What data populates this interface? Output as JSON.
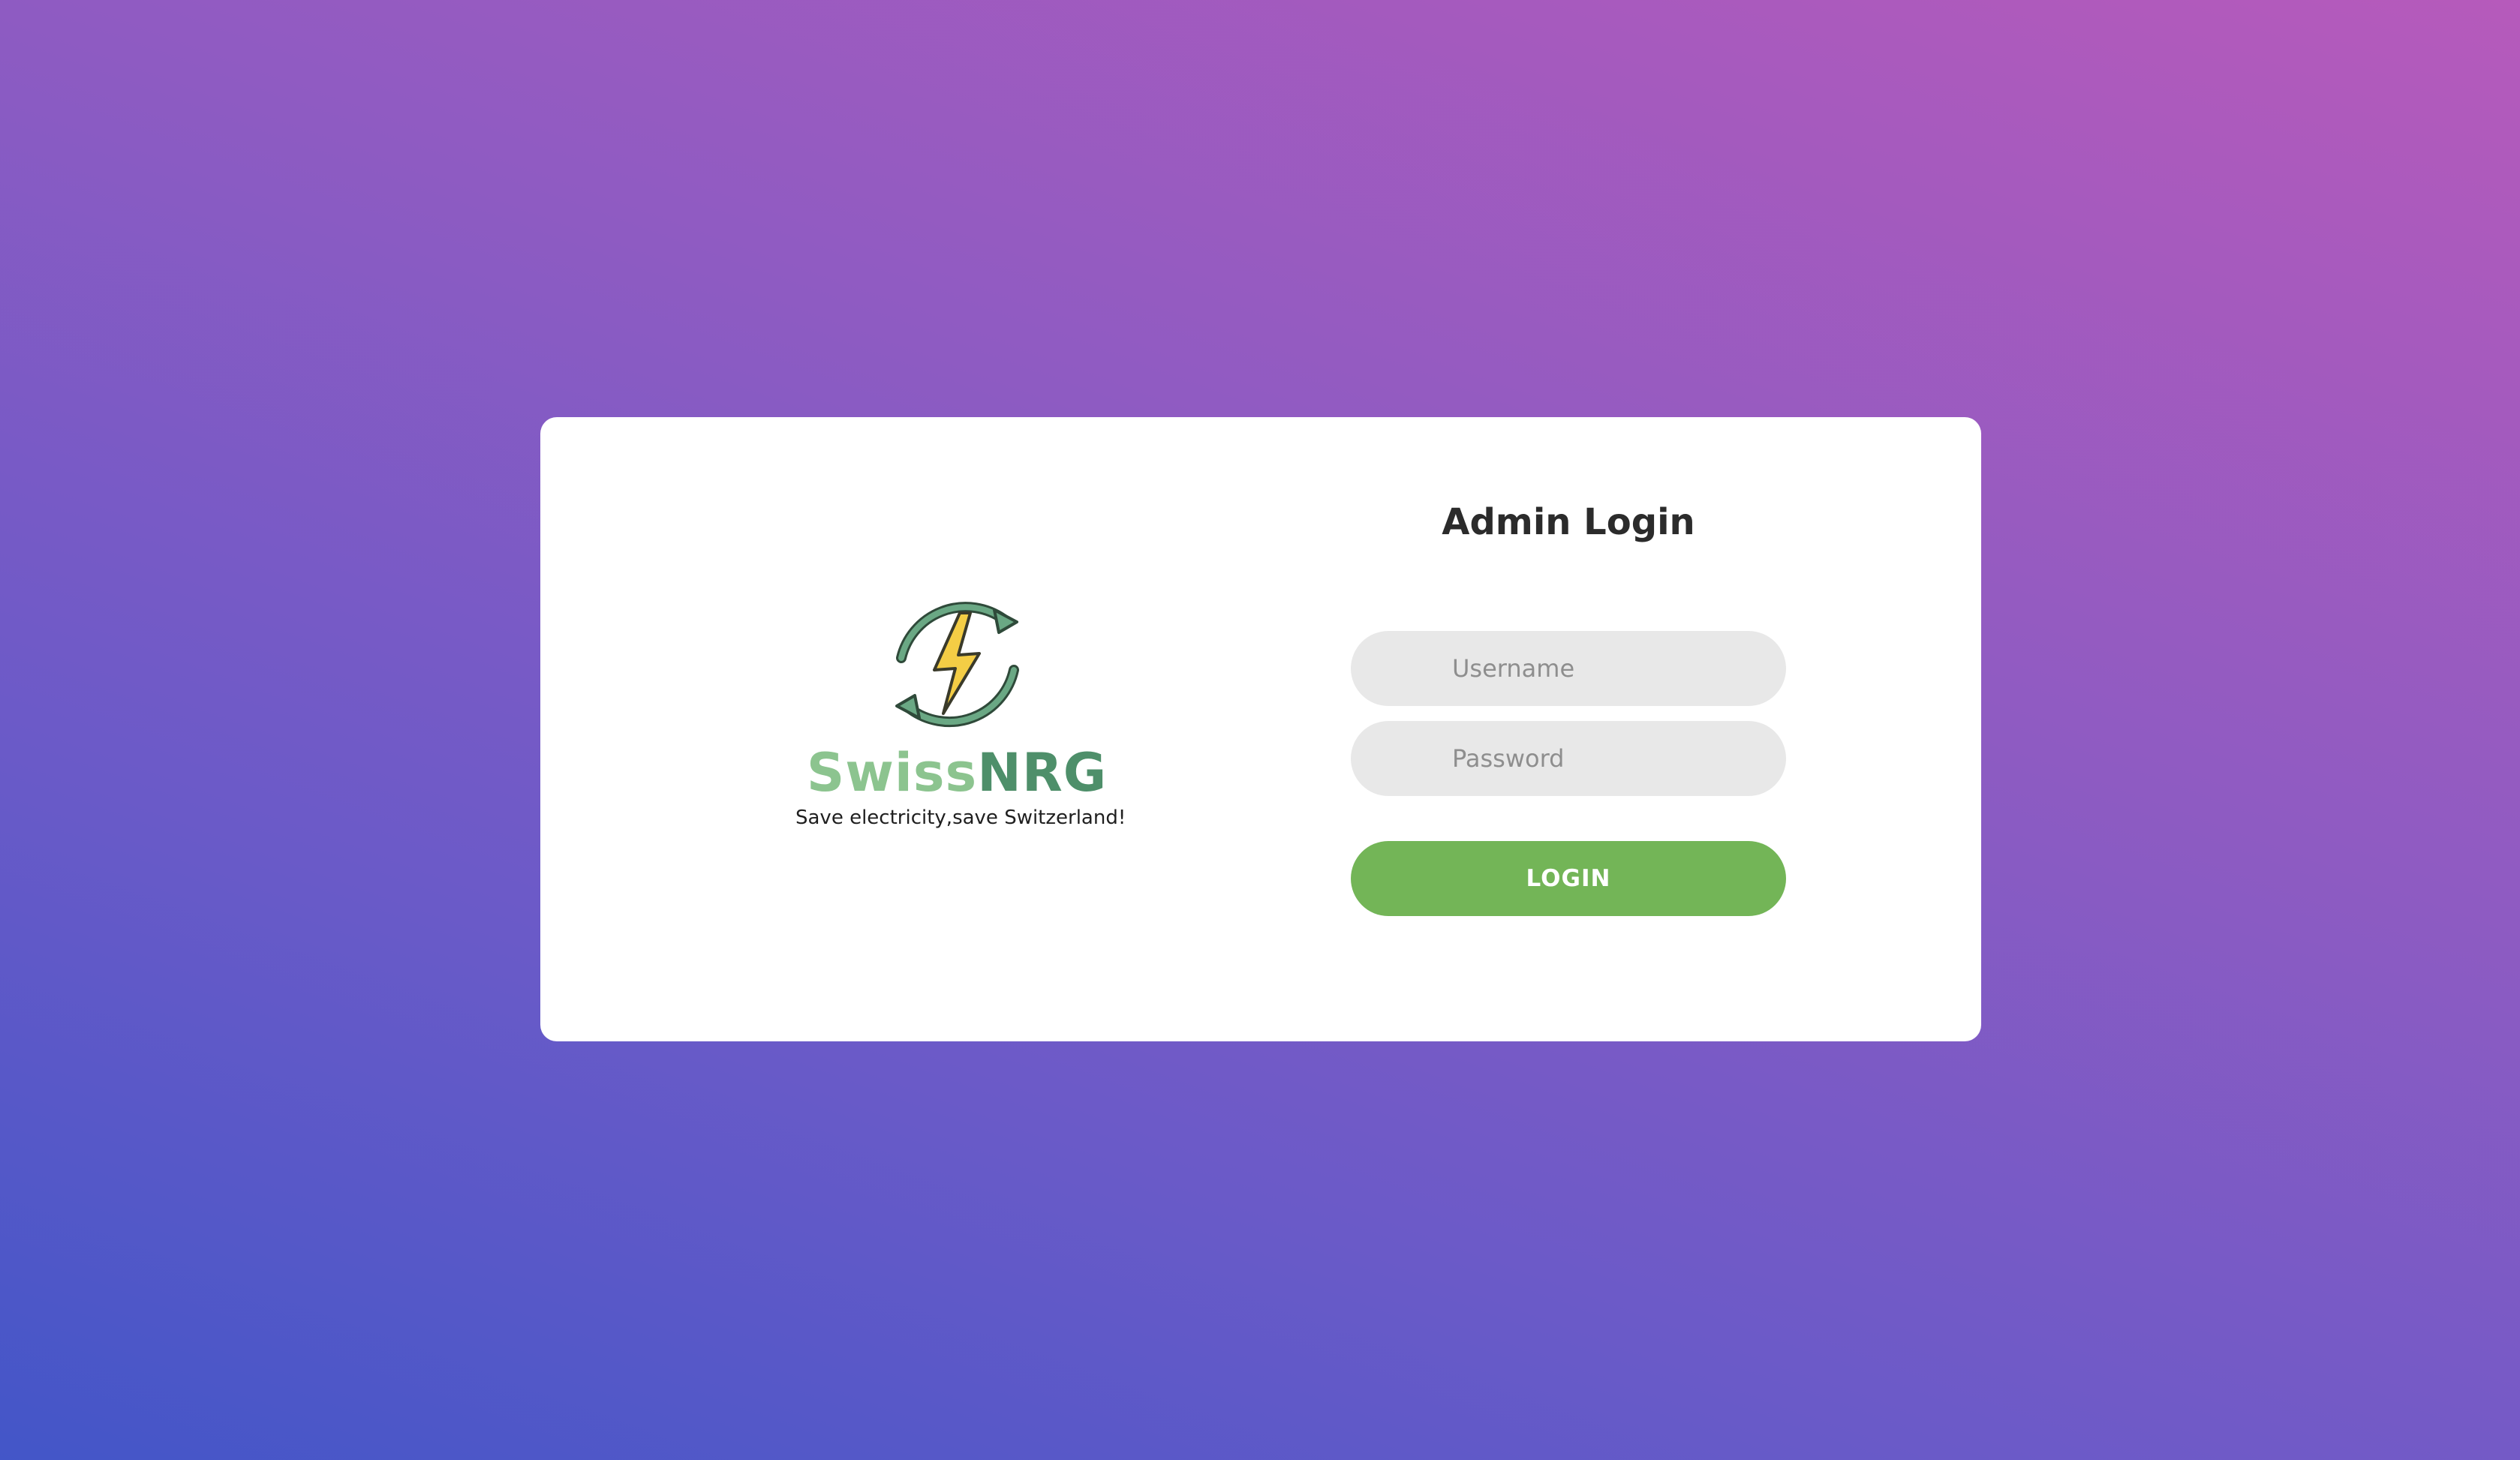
{
  "brand": {
    "name_part1": "Swiss",
    "name_part2": "NRG",
    "tagline": "Save electricity,save Switzerland!",
    "logo_icon": "lightning-recycle-icon",
    "colors": {
      "swiss": "#8cc48f",
      "nrg": "#4e8f6a",
      "bolt": "#f4cd45",
      "arrows": "#4e8f6a"
    }
  },
  "login": {
    "title": "Admin Login",
    "username_placeholder": "Username",
    "password_placeholder": "Password",
    "button_label": "LOGIN",
    "button_color": "#73b557"
  }
}
